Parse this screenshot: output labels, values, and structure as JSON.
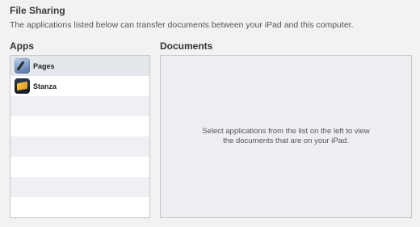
{
  "file_sharing": {
    "title": "File Sharing",
    "description": "The applications listed below can transfer documents between your iPad and this computer."
  },
  "apps": {
    "header": "Apps",
    "items": [
      {
        "label": "Pages",
        "icon": "pages-app-icon"
      },
      {
        "label": "Stanza",
        "icon": "stanza-app-icon"
      }
    ]
  },
  "documents": {
    "header": "Documents",
    "empty_message": "Select applications from the list on the left to view the documents that are on your iPad."
  }
}
